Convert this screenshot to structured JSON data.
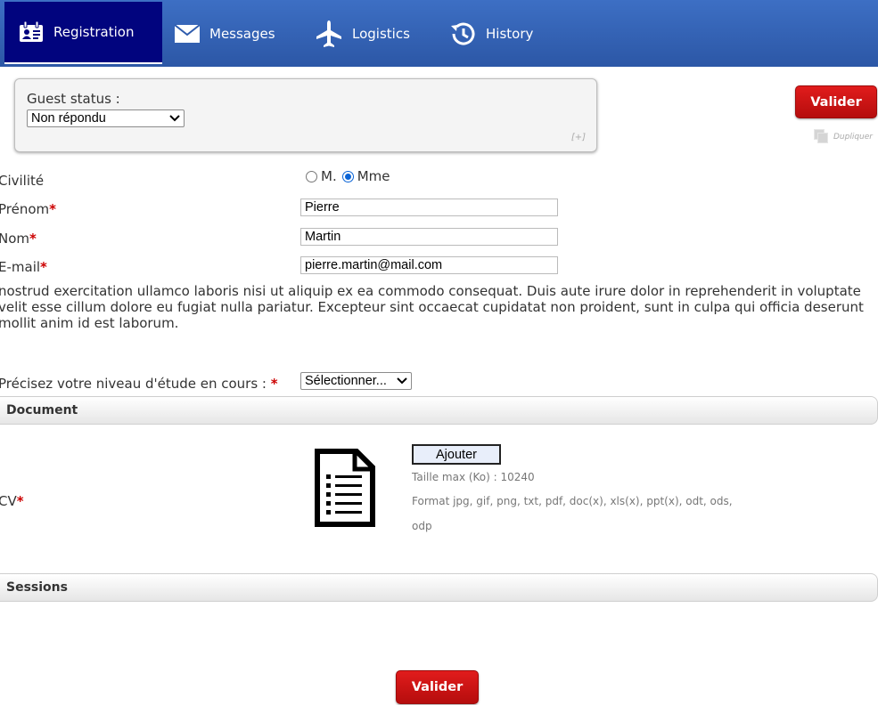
{
  "nav": {
    "tabs": [
      {
        "label": "Registration",
        "icon": "id-card-icon",
        "active": true
      },
      {
        "label": "Messages",
        "icon": "envelope-icon",
        "active": false
      },
      {
        "label": "Logistics",
        "icon": "airplane-icon",
        "active": false
      },
      {
        "label": "History",
        "icon": "history-clock-icon",
        "active": false
      }
    ],
    "colors": {
      "bar": "#2c57a6",
      "active": "#01047e"
    }
  },
  "status": {
    "label": "Guest status :",
    "selected": "Non répondu",
    "expand": "[+]"
  },
  "actions": {
    "valider": "Valider",
    "dupliquer": "Dupliquer",
    "valider_color": "#cc1212"
  },
  "form": {
    "civilite": {
      "label": "Civilité",
      "options": [
        "M.",
        "Mme"
      ],
      "selected": "Mme"
    },
    "prenom": {
      "label": "Prénom",
      "value": "Pierre"
    },
    "nom": {
      "label": "Nom",
      "value": "Martin"
    },
    "email": {
      "label": "E-mail",
      "value": "pierre.martin@mail.com"
    },
    "required_mark": "*",
    "paragraph": "nostrud exercitation ullamco laboris nisi ut aliquip ex ea commodo consequat. Duis aute irure dolor in reprehenderit in voluptate velit esse cillum dolore eu fugiat nulla pariatur. Excepteur sint occaecat cupidatat non proident, sunt in culpa qui officia deserunt mollit anim id est laborum.",
    "level": {
      "label": "Précisez votre niveau d'étude en cours :",
      "selected": "Sélectionner..."
    }
  },
  "document": {
    "title": "Document",
    "cv_label": "CV",
    "upload_button": "Ajouter",
    "max_size": "Taille max (Ko) : 10240",
    "formats_line1": "Format jpg, gif, png, txt, pdf, doc(x), xls(x), ppt(x), odt, ods,",
    "formats_line2": "odp"
  },
  "sessions": {
    "title": "Sessions"
  }
}
